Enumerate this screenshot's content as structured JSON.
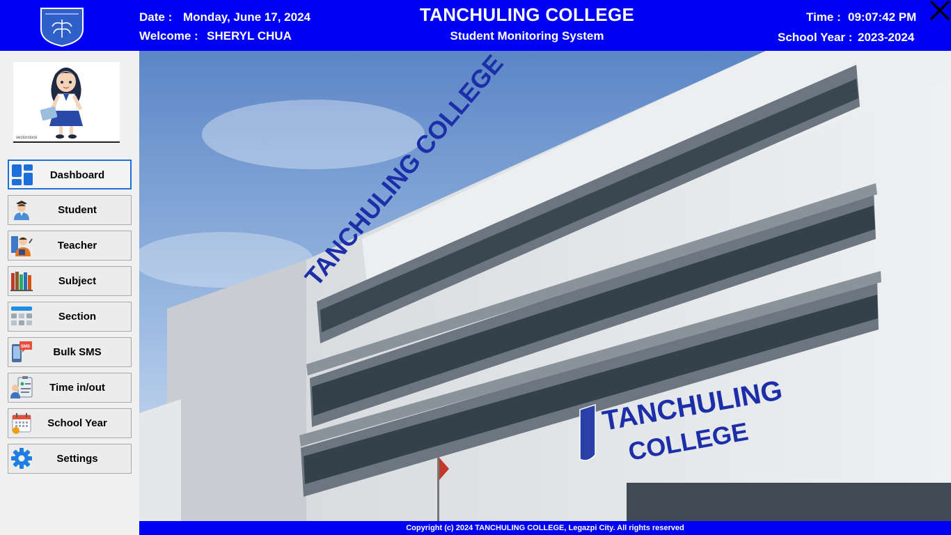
{
  "header": {
    "date_label": "Date :",
    "date_value": "Monday, June 17, 2024",
    "welcome_label": "Welcome :",
    "welcome_value": "SHERYL CHUA",
    "title": "TANCHULING COLLEGE",
    "subtitle": "Student Monitoring System",
    "time_label": "Time :",
    "time_value": "09:07:42 PM",
    "school_year_label": "School Year :",
    "school_year_value": "2023-2024",
    "logo_text": "TANCHULING COLLEGE"
  },
  "avatar": {
    "watermark": "vectorstock"
  },
  "nav": {
    "items": [
      {
        "label": "Dashboard",
        "icon": "dashboard-icon"
      },
      {
        "label": "Student",
        "icon": "student-icon"
      },
      {
        "label": "Teacher",
        "icon": "teacher-icon"
      },
      {
        "label": "Subject",
        "icon": "books-icon"
      },
      {
        "label": "Section",
        "icon": "section-icon"
      },
      {
        "label": "Bulk SMS",
        "icon": "sms-icon"
      },
      {
        "label": "Time in/out",
        "icon": "clipboard-icon"
      },
      {
        "label": "School Year",
        "icon": "calendar-icon"
      },
      {
        "label": "Settings",
        "icon": "gear-icon"
      }
    ]
  },
  "banner": {
    "sign_top": "TANCHULING COLLEGE",
    "sign_line1": "TANCHULING",
    "sign_line2": "COLLEGE"
  },
  "footer": {
    "text": "Copyright (c) 2024 TANCHULING COLLEGE, Legazpi City. All rights reserved"
  },
  "colors": {
    "brand_blue": "#0000f5",
    "active_border": "#1e6fd9",
    "sign_blue": "#1d2fa8"
  }
}
